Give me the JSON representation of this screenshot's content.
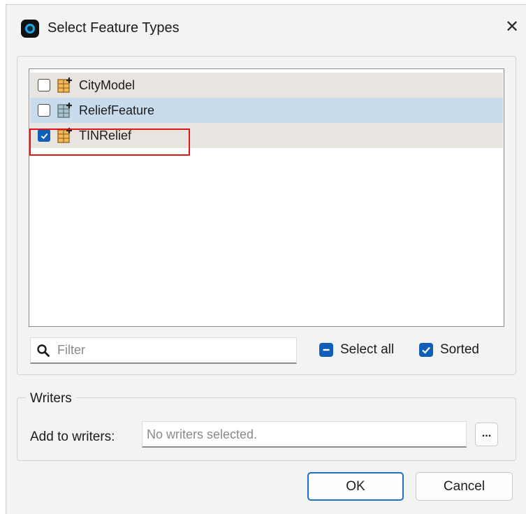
{
  "window": {
    "title": "Select Feature Types",
    "close_symbol": "✕"
  },
  "feature_types": [
    {
      "label": "CityModel",
      "checked": false
    },
    {
      "label": "ReliefFeature",
      "checked": false
    },
    {
      "label": "TINRelief",
      "checked": true
    }
  ],
  "filter": {
    "placeholder": "Filter",
    "value": ""
  },
  "options": {
    "select_all_label": "Select all",
    "sorted_label": "Sorted"
  },
  "writers": {
    "legend": "Writers",
    "add_label": "Add to writers:",
    "field_value": "No writers selected.",
    "browse_label": "..."
  },
  "buttons": {
    "ok": "OK",
    "cancel": "Cancel"
  },
  "colors": {
    "accent": "#0f5fb8",
    "selected_row": "#c8dced",
    "highlight_box": "#e01515"
  }
}
